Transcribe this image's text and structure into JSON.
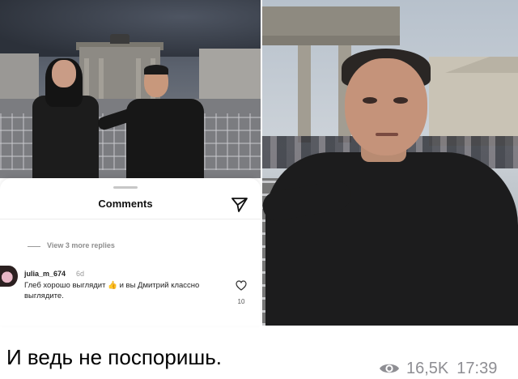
{
  "comments_panel": {
    "title": "Comments",
    "view_replies": "View 3 more replies",
    "comment": {
      "username": "julia_m_674",
      "time": "6d",
      "text": "Глеб хорошо выглядит 👍 и вы Дмитрий классно выглядите.",
      "likes": "10"
    }
  },
  "message": {
    "text": "И ведь не поспоришь.",
    "views": "16,5K",
    "time": "17:39"
  },
  "icons": {
    "send": "send-icon",
    "like": "heart-outline-icon",
    "views": "eye-icon"
  }
}
